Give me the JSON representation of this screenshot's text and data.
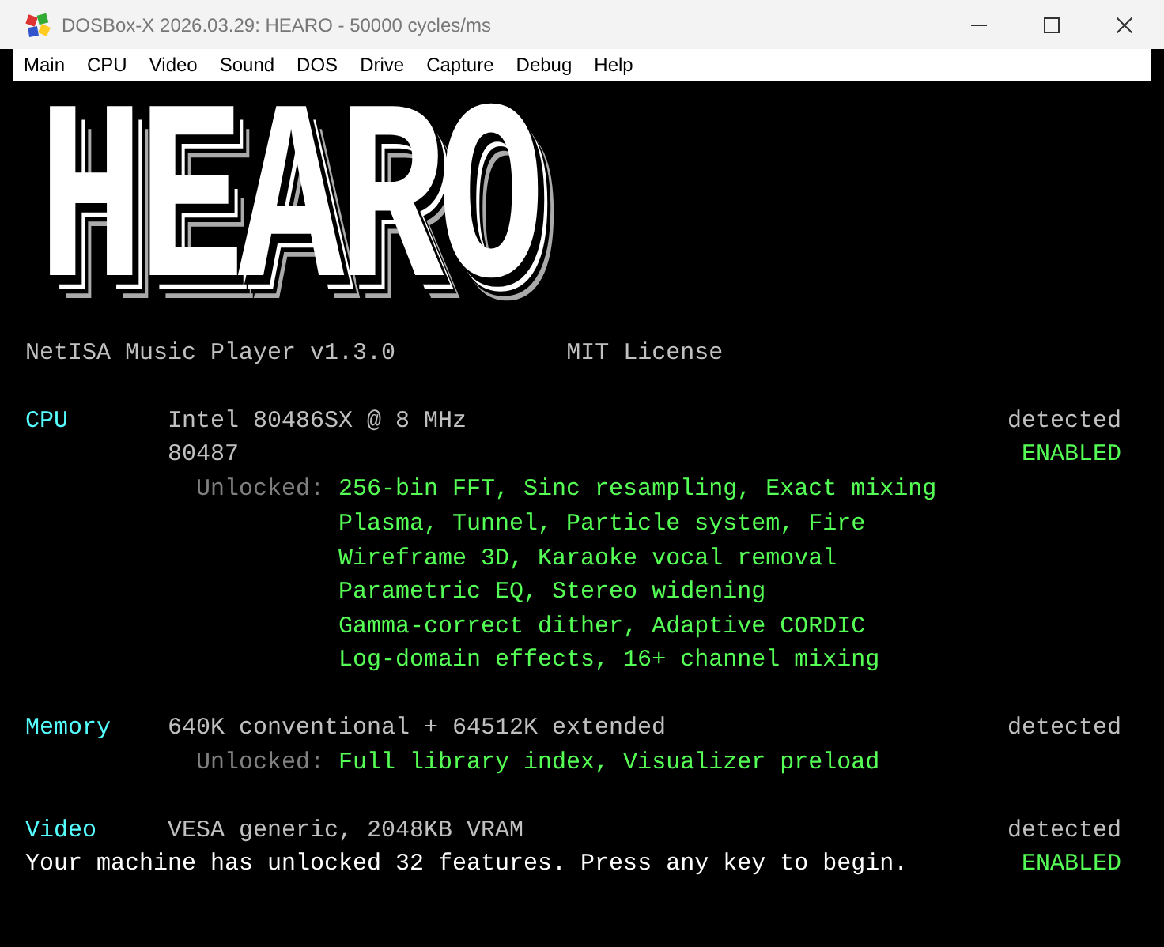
{
  "window": {
    "title": "DOSBox-X 2026.03.29: HEARO - 50000 cycles/ms"
  },
  "menu": [
    "Main",
    "CPU",
    "Video",
    "Sound",
    "DOS",
    "Drive",
    "Capture",
    "Debug",
    "Help"
  ],
  "logo": "HEARO",
  "header": {
    "title": "NetISA Music Player v1.3.0",
    "license": "MIT License"
  },
  "devices": [
    {
      "label": "CPU",
      "value": "Intel 80486SX @ 8 MHz",
      "status": {
        "text": "detected",
        "kind": "detected"
      },
      "subs": [
        {
          "value": "80487",
          "status": {
            "text": "ENABLED",
            "kind": "enabled"
          }
        }
      ],
      "unlocked": {
        "label": "Unlocked:",
        "features": [
          "256-bin FFT, Sinc resampling, Exact mixing",
          "Plasma, Tunnel, Particle system, Fire",
          "Wireframe 3D, Karaoke vocal removal",
          "Parametric EQ, Stereo widening",
          "Gamma-correct dither, Adaptive CORDIC",
          "Log-domain effects, 16+ channel mixing"
        ]
      }
    },
    {
      "label": "Memory",
      "value": "640K conventional + 64512K extended",
      "status": {
        "text": "detected",
        "kind": "detected"
      },
      "unlocked": {
        "label": "Unlocked:",
        "features": [
          "Full library index, Visualizer preload"
        ]
      }
    },
    {
      "label": "Video",
      "value": "VESA generic, 2048KB VRAM",
      "status": {
        "text": "detected",
        "kind": "detected"
      }
    }
  ],
  "footer": {
    "message": "Your machine has unlocked 32 features. Press any key to begin.",
    "status": {
      "text": "ENABLED",
      "kind": "enabled"
    }
  }
}
